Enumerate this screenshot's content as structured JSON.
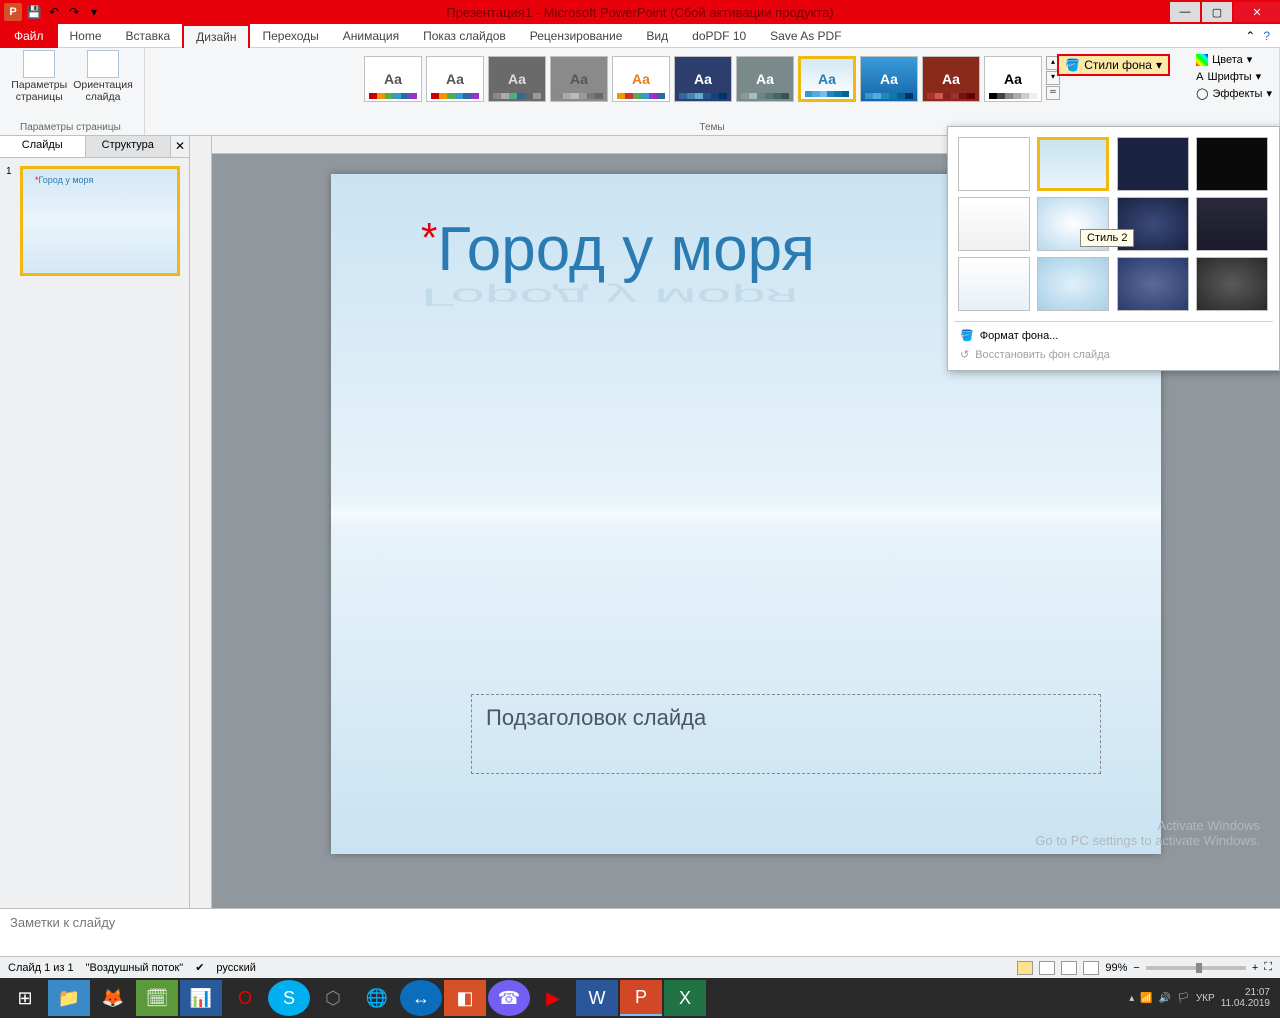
{
  "title": "Презентация1 - Microsoft PowerPoint (Сбой активации продукта)",
  "tabs": {
    "file": "Файл",
    "items": [
      "Home",
      "Вставка",
      "Дизайн",
      "Переходы",
      "Анимация",
      "Показ слайдов",
      "Рецензирование",
      "Вид",
      "doPDF 10",
      "Save As PDF"
    ],
    "active": "Дизайн"
  },
  "ribbon": {
    "page_params": {
      "label": "Параметры страницы",
      "btn1": "Параметры\nстраницы",
      "btn2": "Ориентация\nслайда"
    },
    "themes_label": "Темы",
    "colors": "Цвета",
    "fonts": "Шрифты",
    "effects": "Эффекты",
    "bg_styles": "Стили фона"
  },
  "bg_dropdown": {
    "tooltip": "Стиль 2",
    "format": "Формат фона...",
    "restore": "Восстановить фон слайда"
  },
  "sidebar": {
    "tab1": "Слайды",
    "tab2": "Структура",
    "thumb_title": "Город у моря",
    "slide_num": "1"
  },
  "slide": {
    "title": "Город у моря",
    "subtitle": "Подзаголовок слайда"
  },
  "notes": "Заметки к слайду",
  "watermark": {
    "l1": "Activate Windows",
    "l2": "Go to PC settings to activate Windows."
  },
  "status": {
    "slide": "Слайд 1 из 1",
    "theme": "\"Воздушный поток\"",
    "lang": "русский",
    "zoom": "99%"
  },
  "tray": {
    "lang": "УКР",
    "time": "21:07",
    "date": "11.04.2019"
  }
}
